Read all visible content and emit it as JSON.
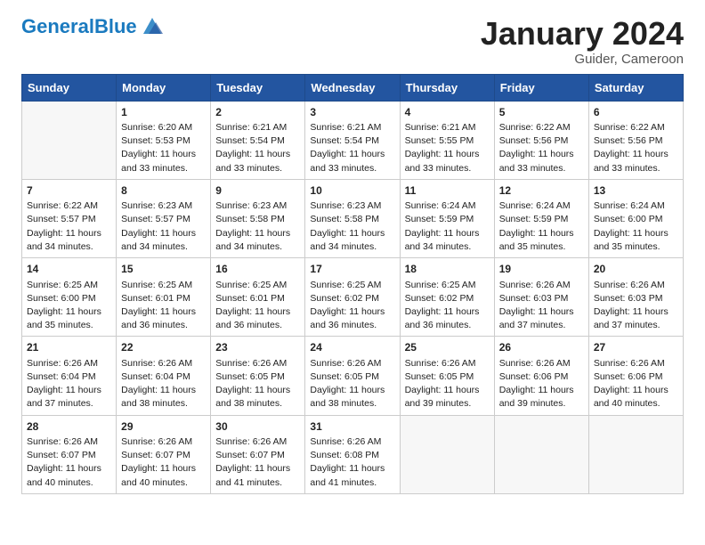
{
  "header": {
    "logo_text_black": "General",
    "logo_text_blue": "Blue",
    "month_title": "January 2024",
    "location": "Guider, Cameroon"
  },
  "days_of_week": [
    "Sunday",
    "Monday",
    "Tuesday",
    "Wednesday",
    "Thursday",
    "Friday",
    "Saturday"
  ],
  "weeks": [
    [
      {
        "day": "",
        "info": ""
      },
      {
        "day": "1",
        "info": "Sunrise: 6:20 AM\nSunset: 5:53 PM\nDaylight: 11 hours\nand 33 minutes."
      },
      {
        "day": "2",
        "info": "Sunrise: 6:21 AM\nSunset: 5:54 PM\nDaylight: 11 hours\nand 33 minutes."
      },
      {
        "day": "3",
        "info": "Sunrise: 6:21 AM\nSunset: 5:54 PM\nDaylight: 11 hours\nand 33 minutes."
      },
      {
        "day": "4",
        "info": "Sunrise: 6:21 AM\nSunset: 5:55 PM\nDaylight: 11 hours\nand 33 minutes."
      },
      {
        "day": "5",
        "info": "Sunrise: 6:22 AM\nSunset: 5:56 PM\nDaylight: 11 hours\nand 33 minutes."
      },
      {
        "day": "6",
        "info": "Sunrise: 6:22 AM\nSunset: 5:56 PM\nDaylight: 11 hours\nand 33 minutes."
      }
    ],
    [
      {
        "day": "7",
        "info": "Sunrise: 6:22 AM\nSunset: 5:57 PM\nDaylight: 11 hours\nand 34 minutes."
      },
      {
        "day": "8",
        "info": "Sunrise: 6:23 AM\nSunset: 5:57 PM\nDaylight: 11 hours\nand 34 minutes."
      },
      {
        "day": "9",
        "info": "Sunrise: 6:23 AM\nSunset: 5:58 PM\nDaylight: 11 hours\nand 34 minutes."
      },
      {
        "day": "10",
        "info": "Sunrise: 6:23 AM\nSunset: 5:58 PM\nDaylight: 11 hours\nand 34 minutes."
      },
      {
        "day": "11",
        "info": "Sunrise: 6:24 AM\nSunset: 5:59 PM\nDaylight: 11 hours\nand 34 minutes."
      },
      {
        "day": "12",
        "info": "Sunrise: 6:24 AM\nSunset: 5:59 PM\nDaylight: 11 hours\nand 35 minutes."
      },
      {
        "day": "13",
        "info": "Sunrise: 6:24 AM\nSunset: 6:00 PM\nDaylight: 11 hours\nand 35 minutes."
      }
    ],
    [
      {
        "day": "14",
        "info": "Sunrise: 6:25 AM\nSunset: 6:00 PM\nDaylight: 11 hours\nand 35 minutes."
      },
      {
        "day": "15",
        "info": "Sunrise: 6:25 AM\nSunset: 6:01 PM\nDaylight: 11 hours\nand 36 minutes."
      },
      {
        "day": "16",
        "info": "Sunrise: 6:25 AM\nSunset: 6:01 PM\nDaylight: 11 hours\nand 36 minutes."
      },
      {
        "day": "17",
        "info": "Sunrise: 6:25 AM\nSunset: 6:02 PM\nDaylight: 11 hours\nand 36 minutes."
      },
      {
        "day": "18",
        "info": "Sunrise: 6:25 AM\nSunset: 6:02 PM\nDaylight: 11 hours\nand 36 minutes."
      },
      {
        "day": "19",
        "info": "Sunrise: 6:26 AM\nSunset: 6:03 PM\nDaylight: 11 hours\nand 37 minutes."
      },
      {
        "day": "20",
        "info": "Sunrise: 6:26 AM\nSunset: 6:03 PM\nDaylight: 11 hours\nand 37 minutes."
      }
    ],
    [
      {
        "day": "21",
        "info": "Sunrise: 6:26 AM\nSunset: 6:04 PM\nDaylight: 11 hours\nand 37 minutes."
      },
      {
        "day": "22",
        "info": "Sunrise: 6:26 AM\nSunset: 6:04 PM\nDaylight: 11 hours\nand 38 minutes."
      },
      {
        "day": "23",
        "info": "Sunrise: 6:26 AM\nSunset: 6:05 PM\nDaylight: 11 hours\nand 38 minutes."
      },
      {
        "day": "24",
        "info": "Sunrise: 6:26 AM\nSunset: 6:05 PM\nDaylight: 11 hours\nand 38 minutes."
      },
      {
        "day": "25",
        "info": "Sunrise: 6:26 AM\nSunset: 6:05 PM\nDaylight: 11 hours\nand 39 minutes."
      },
      {
        "day": "26",
        "info": "Sunrise: 6:26 AM\nSunset: 6:06 PM\nDaylight: 11 hours\nand 39 minutes."
      },
      {
        "day": "27",
        "info": "Sunrise: 6:26 AM\nSunset: 6:06 PM\nDaylight: 11 hours\nand 40 minutes."
      }
    ],
    [
      {
        "day": "28",
        "info": "Sunrise: 6:26 AM\nSunset: 6:07 PM\nDaylight: 11 hours\nand 40 minutes."
      },
      {
        "day": "29",
        "info": "Sunrise: 6:26 AM\nSunset: 6:07 PM\nDaylight: 11 hours\nand 40 minutes."
      },
      {
        "day": "30",
        "info": "Sunrise: 6:26 AM\nSunset: 6:07 PM\nDaylight: 11 hours\nand 41 minutes."
      },
      {
        "day": "31",
        "info": "Sunrise: 6:26 AM\nSunset: 6:08 PM\nDaylight: 11 hours\nand 41 minutes."
      },
      {
        "day": "",
        "info": ""
      },
      {
        "day": "",
        "info": ""
      },
      {
        "day": "",
        "info": ""
      }
    ]
  ]
}
